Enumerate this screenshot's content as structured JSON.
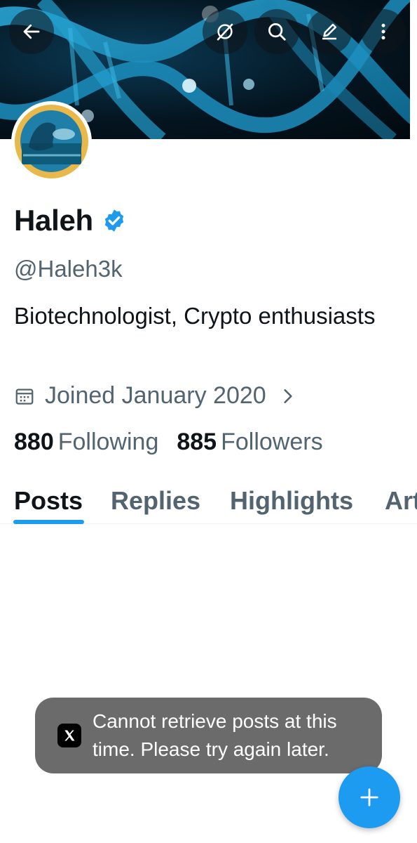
{
  "header": {
    "back_icon": "arrow-left-icon",
    "grok_icon": "grok-icon",
    "search_icon": "search-icon",
    "edit_icon": "pencil-icon",
    "more_icon": "more-vertical-icon"
  },
  "profile": {
    "name": "Haleh",
    "verified": true,
    "handle": "@Haleh3k",
    "bio": "Biotechnologist, Crypto enthusiasts",
    "joined": "Joined January 2020",
    "following_count": "880",
    "following_label": "Following",
    "followers_count": "885",
    "followers_label": "Followers"
  },
  "tabs": [
    {
      "label": "Posts",
      "active": true
    },
    {
      "label": "Replies",
      "active": false
    },
    {
      "label": "Highlights",
      "active": false
    },
    {
      "label": "Articles",
      "active": false
    }
  ],
  "toast": {
    "message": "Cannot retrieve posts at this time. Please try again later."
  },
  "fab": {
    "icon": "plus-icon"
  },
  "colors": {
    "accent": "#1d9bf0",
    "text_primary": "#0f1419",
    "text_secondary": "#536471",
    "toast_bg": "#6b6b6b"
  }
}
